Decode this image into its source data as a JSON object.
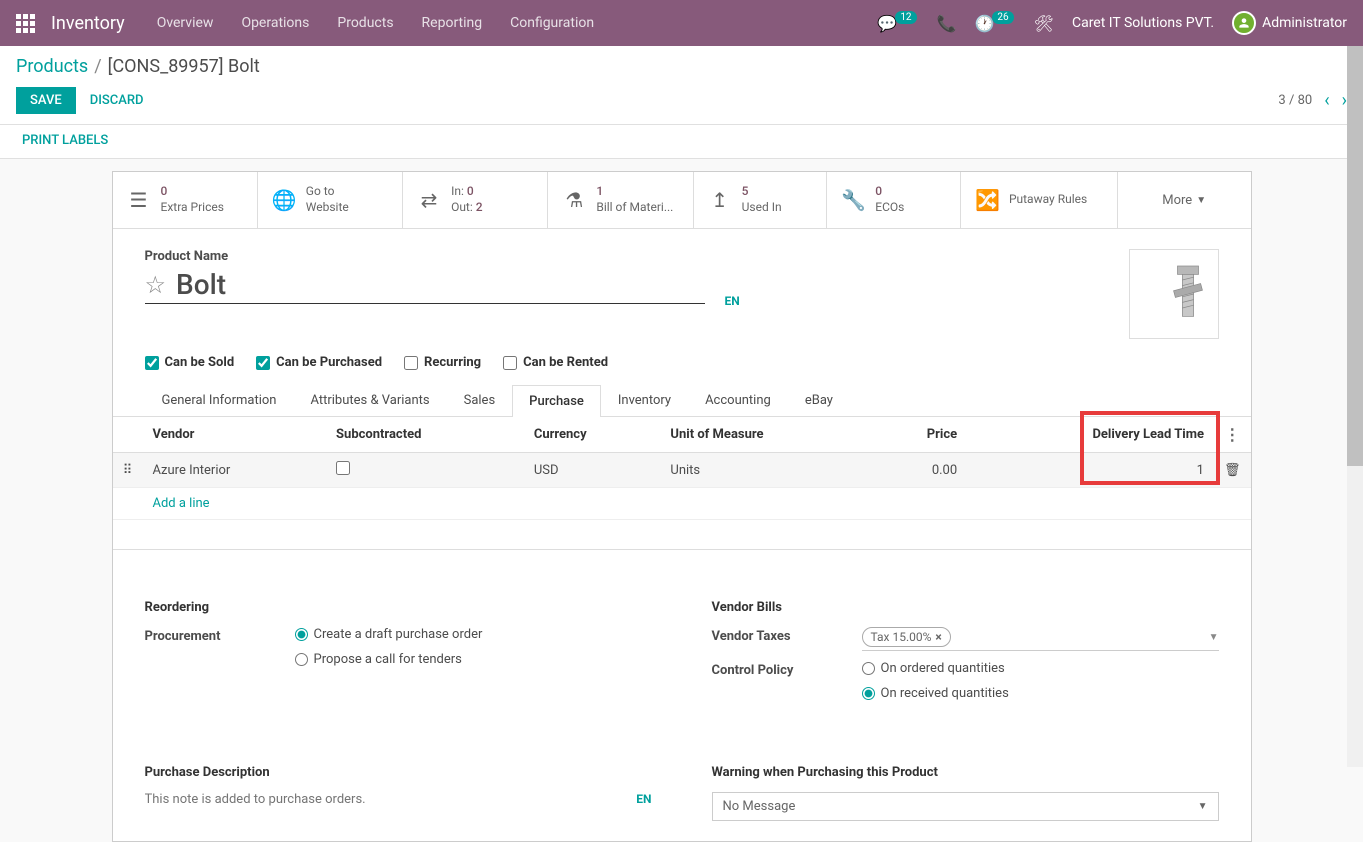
{
  "topbar": {
    "module": "Inventory",
    "menu": [
      "Overview",
      "Operations",
      "Products",
      "Reporting",
      "Configuration"
    ],
    "messages_badge": "12",
    "activities_badge": "26",
    "company": "Caret IT Solutions PVT.",
    "user": "Administrator"
  },
  "breadcrumb": {
    "parent": "Products",
    "current": "[CONS_89957] Bolt"
  },
  "actions": {
    "save": "SAVE",
    "discard": "DISCARD",
    "pager_current": "3",
    "pager_total": "80"
  },
  "print_labels": "PRINT LABELS",
  "stat_buttons": {
    "extra_prices": {
      "value": "0",
      "label": "Extra Prices"
    },
    "website": {
      "label1": "Go to",
      "label2": "Website"
    },
    "transfers": {
      "in_label": "In:",
      "in_value": "0",
      "out_label": "Out:",
      "out_value": "2"
    },
    "bom": {
      "value": "1",
      "label": "Bill of Materi..."
    },
    "used_in": {
      "value": "5",
      "label": "Used In"
    },
    "ecos": {
      "value": "0",
      "label": "ECOs"
    },
    "putaway": {
      "label": "Putaway Rules"
    },
    "more": "More"
  },
  "product": {
    "name_label": "Product Name",
    "name_value": "Bolt",
    "lang": "EN"
  },
  "checkboxes": {
    "can_be_sold": "Can be Sold",
    "can_be_purchased": "Can be Purchased",
    "recurring": "Recurring",
    "can_be_rented": "Can be Rented"
  },
  "tabs": [
    "General Information",
    "Attributes & Variants",
    "Sales",
    "Purchase",
    "Inventory",
    "Accounting",
    "eBay"
  ],
  "active_tab_index": 3,
  "vendor_table": {
    "headers": {
      "vendor": "Vendor",
      "subcontracted": "Subcontracted",
      "currency": "Currency",
      "uom": "Unit of Measure",
      "price": "Price",
      "lead_time": "Delivery Lead Time"
    },
    "rows": [
      {
        "vendor": "Azure Interior",
        "currency": "USD",
        "uom": "Units",
        "price": "0.00",
        "lead_time": "1"
      }
    ],
    "add_line": "Add a line"
  },
  "reordering": {
    "title": "Reordering",
    "procurement_label": "Procurement",
    "option_draft": "Create a draft purchase order",
    "option_tender": "Propose a call for tenders"
  },
  "vendor_bills": {
    "title": "Vendor Bills",
    "taxes_label": "Vendor Taxes",
    "tax_tag": "Tax 15.00%",
    "control_label": "Control Policy",
    "option_ordered": "On ordered quantities",
    "option_received": "On received quantities"
  },
  "purchase_desc": {
    "title": "Purchase Description",
    "placeholder": "This note is added to purchase orders.",
    "lang": "EN"
  },
  "warning": {
    "title": "Warning when Purchasing this Product",
    "value": "No Message"
  }
}
